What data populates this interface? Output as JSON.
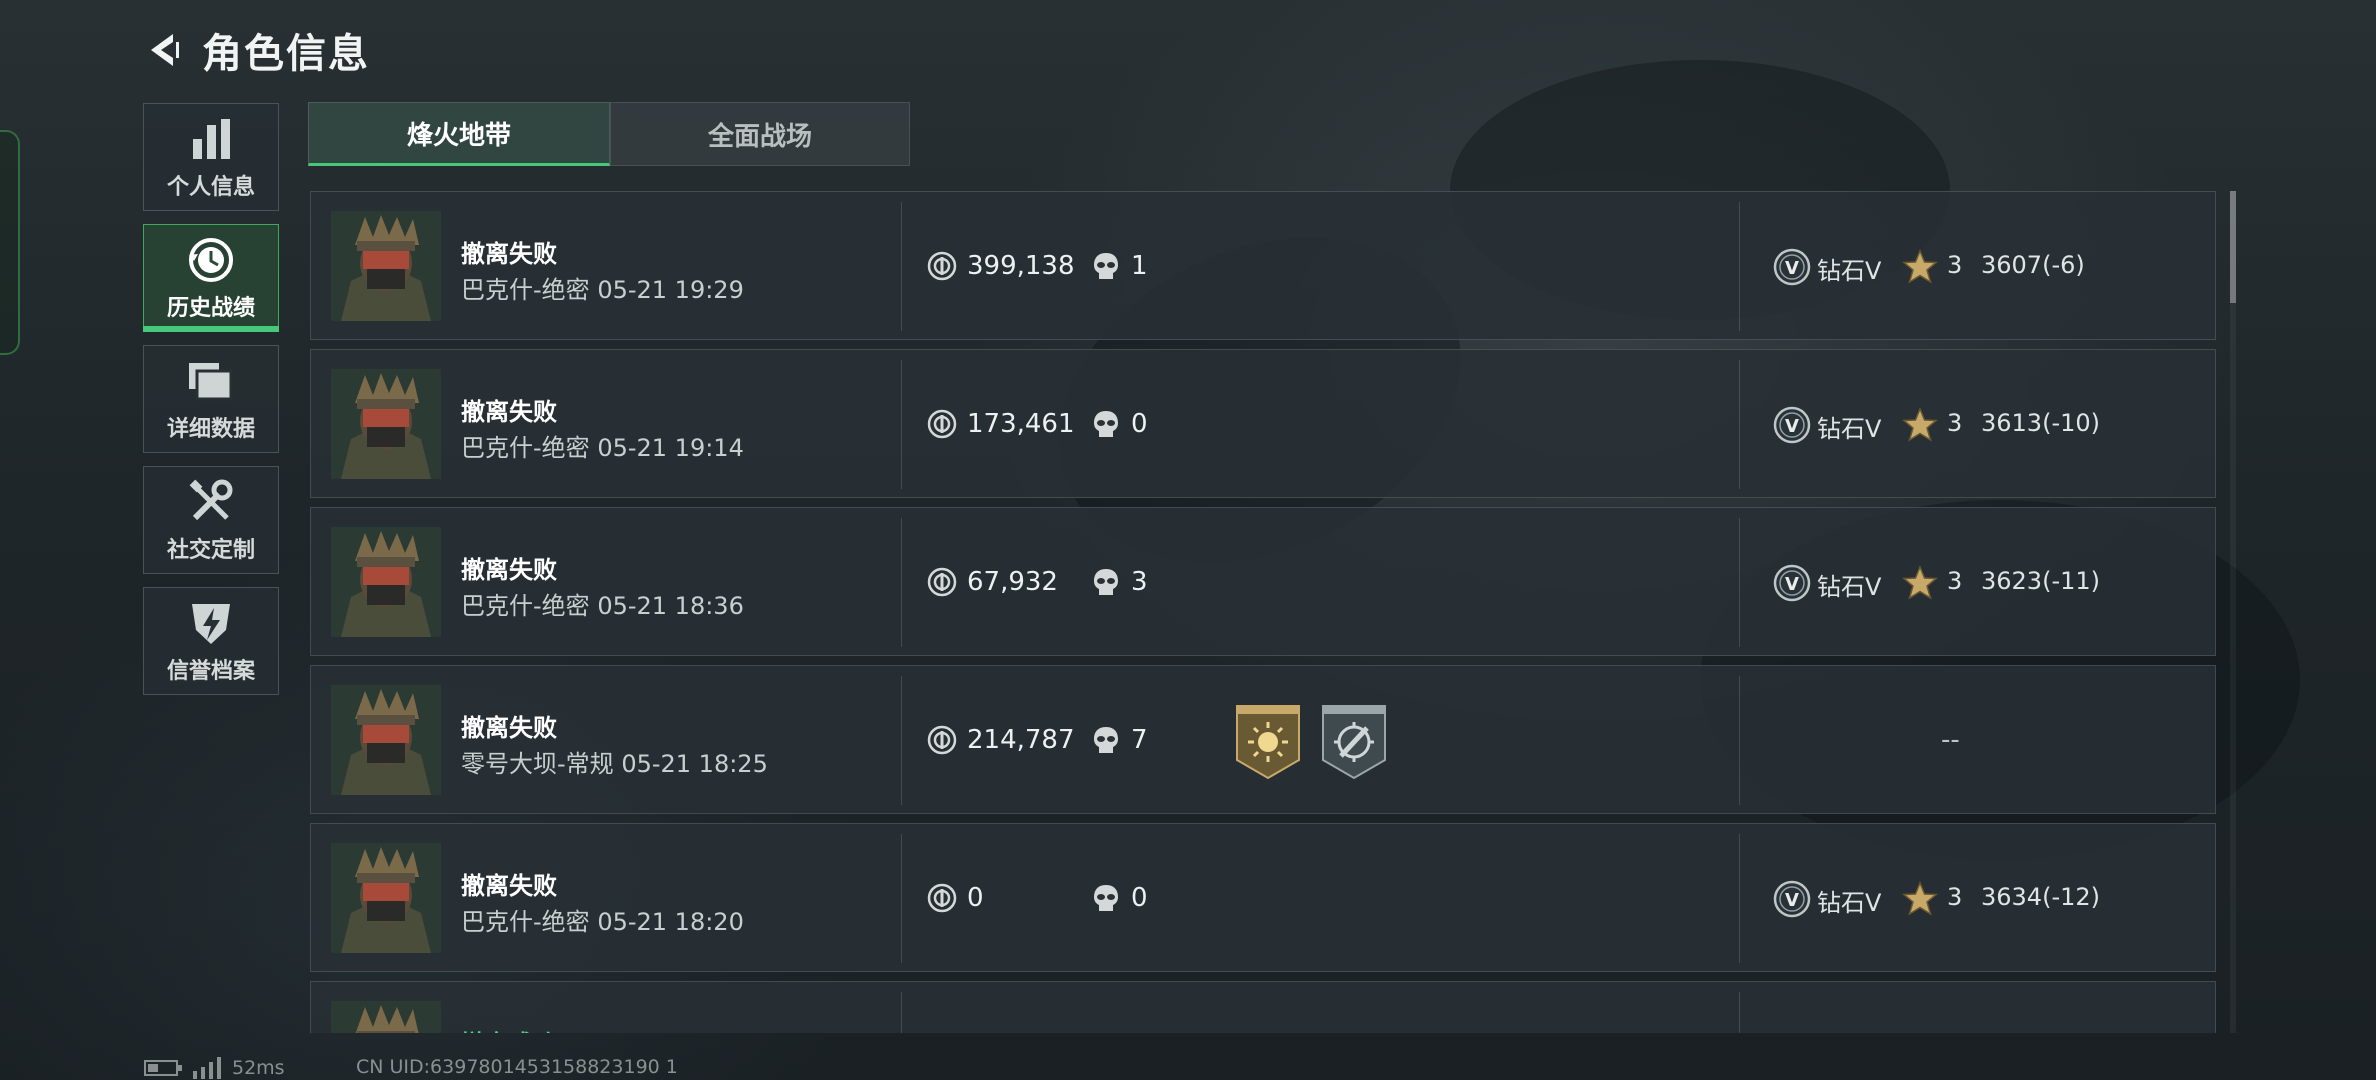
{
  "header": {
    "title": "角色信息"
  },
  "sidebar": {
    "items": [
      {
        "label": "个人信息",
        "icon": "bar-chart-icon",
        "active": false
      },
      {
        "label": "历史战绩",
        "icon": "history-clock-icon",
        "active": true
      },
      {
        "label": "详细数据",
        "icon": "folder-icon",
        "active": false
      },
      {
        "label": "社交定制",
        "icon": "tools-icon",
        "active": false
      },
      {
        "label": "信誉档案",
        "icon": "shield-bolt-icon",
        "active": false
      }
    ]
  },
  "tabs": [
    {
      "label": "烽火地带",
      "active": true
    },
    {
      "label": "全面战场",
      "active": false
    }
  ],
  "records": [
    {
      "outcome": "撤离失败",
      "map": "巴克什-绝密",
      "time": "05-21 19:29",
      "value": "399,138",
      "kills": "1",
      "rank": "钻石V",
      "stars": "3",
      "score": "3607(-6)"
    },
    {
      "outcome": "撤离失败",
      "map": "巴克什-绝密",
      "time": "05-21 19:14",
      "value": "173,461",
      "kills": "0",
      "rank": "钻石V",
      "stars": "3",
      "score": "3613(-10)"
    },
    {
      "outcome": "撤离失败",
      "map": "巴克什-绝密",
      "time": "05-21 18:36",
      "value": "67,932",
      "kills": "3",
      "rank": "钻石V",
      "stars": "3",
      "score": "3623(-11)"
    },
    {
      "outcome": "撤离失败",
      "map": "零号大坝-常规",
      "time": "05-21 18:25",
      "value": "214,787",
      "kills": "7",
      "rank_placeholder": "--",
      "badges": [
        "sun-emblem-badge-icon",
        "crosshair-badge-icon"
      ]
    },
    {
      "outcome": "撤离失败",
      "map": "巴克什-绝密",
      "time": "05-21 18:20",
      "value": "0",
      "kills": "0",
      "rank": "钻石V",
      "stars": "3",
      "score": "3634(-12)"
    },
    {
      "outcome": "撤离成功"
    }
  ],
  "footer": {
    "ping": "52ms",
    "uid": "CN UID:6397801453158823190 1"
  },
  "colors": {
    "accent_green": "#46c97b",
    "success_text": "#4fd686",
    "gold": "#c8a96a"
  }
}
